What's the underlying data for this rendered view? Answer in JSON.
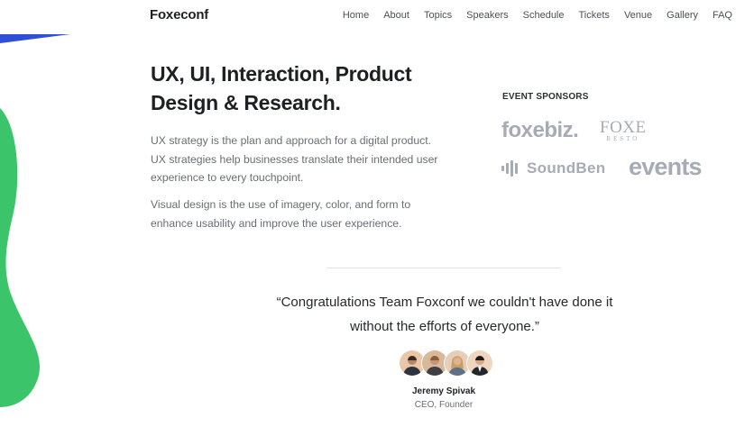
{
  "brand": {
    "name": "Foxeconf"
  },
  "nav": {
    "items": [
      {
        "label": "Home"
      },
      {
        "label": "About"
      },
      {
        "label": "Topics"
      },
      {
        "label": "Speakers"
      },
      {
        "label": "Schedule"
      },
      {
        "label": "Tickets"
      },
      {
        "label": "Venue"
      },
      {
        "label": "Gallery"
      },
      {
        "label": "FAQ"
      }
    ]
  },
  "hero": {
    "title": "UX, UI, Interaction, Product Design & Research.",
    "paragraph_1": "UX strategy is the plan and approach for a digital product. UX strategies help businesses translate their intended user experience to every touchpoint.",
    "paragraph_2": "Visual design is the use of imagery, color, and form to enhance usability and improve the user experience."
  },
  "sponsors": {
    "heading": "EVENT SPONSORS",
    "logos": [
      {
        "name": "foxebiz."
      },
      {
        "name": "FOXE",
        "sub": "RESTO"
      },
      {
        "name": "SoundBen"
      },
      {
        "name": "events"
      }
    ]
  },
  "testimonial": {
    "quote": "“Congratulations Team Foxconf we couldn't have done it without the efforts of everyone.”",
    "name": "Jeremy Spivak",
    "role": "CEO, Founder"
  },
  "colors": {
    "accent_blue": "#2f4fd8",
    "accent_green": "#3cc46a",
    "logo_gray": "#a6abb5"
  }
}
